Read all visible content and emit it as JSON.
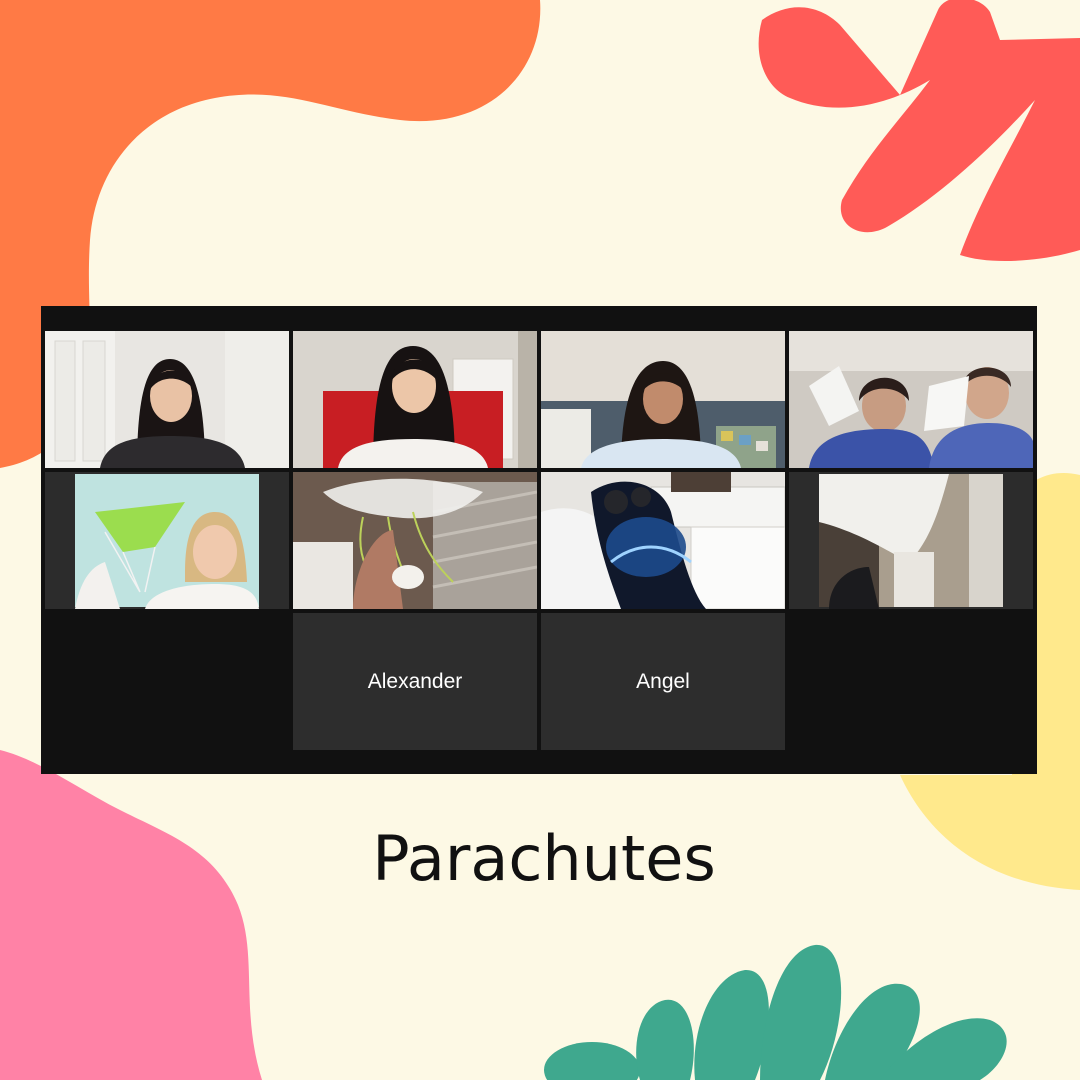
{
  "slide": {
    "caption": "Parachutes"
  },
  "colors": {
    "background": "#fdf9e5",
    "blob_orange": "#ff7a45",
    "blob_red": "#ff5b57",
    "blob_pink": "#ff82a6",
    "blob_yellow": "#ffe98c",
    "blob_teal": "#3fa88e",
    "meeting_background": "#111111",
    "tile_background": "#2d2d2d",
    "active_speaker_border": "#c9e06a"
  },
  "meeting": {
    "participants": [
      {
        "label": "",
        "video": "on",
        "scene": "girl-white-door"
      },
      {
        "label": "",
        "video": "on",
        "scene": "girl-red-chair"
      },
      {
        "label": "",
        "video": "on",
        "scene": "girl-blue-wall"
      },
      {
        "label": "",
        "video": "on",
        "scene": "two-kids-blurred"
      },
      {
        "label": "",
        "video": "on",
        "scene": "girl-green-parachute",
        "active_speaker": true
      },
      {
        "label": "",
        "video": "on",
        "scene": "plastic-parachute-strings"
      },
      {
        "label": "",
        "video": "on",
        "scene": "earth-virtual-background"
      },
      {
        "label": "",
        "video": "on",
        "scene": "paper-parachute-room"
      },
      {
        "label": "Alexander",
        "video": "off"
      },
      {
        "label": "Angel",
        "video": "off"
      }
    ]
  }
}
